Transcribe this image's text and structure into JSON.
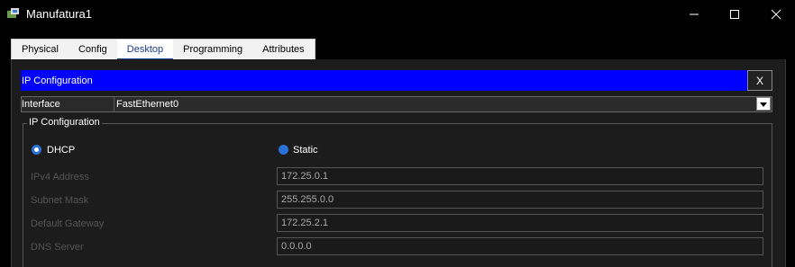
{
  "window": {
    "title": "Manufatura1"
  },
  "tabs": [
    {
      "label": "Physical",
      "active": false
    },
    {
      "label": "Config",
      "active": false
    },
    {
      "label": "Desktop",
      "active": true
    },
    {
      "label": "Programming",
      "active": false
    },
    {
      "label": "Attributes",
      "active": false
    }
  ],
  "header": {
    "title": "IP Configuration",
    "close_label": "X",
    "bar_color": "#0000ff"
  },
  "interface": {
    "label": "Interface",
    "value": "FastEthernet0"
  },
  "ip_config": {
    "group_title": "IP Configuration",
    "dhcp_label": "DHCP",
    "static_label": "Static",
    "selected_mode": "DHCP",
    "fields": [
      {
        "label": "IPv4 Address",
        "value": "172.25.0.1"
      },
      {
        "label": "Subnet Mask",
        "value": "255.255.0.0"
      },
      {
        "label": "Default Gateway",
        "value": "172.25.2.1"
      },
      {
        "label": "DNS Server",
        "value": "0.0.0.0"
      }
    ]
  },
  "icons": [
    "app-icon",
    "minimize-icon",
    "maximize-icon",
    "close-icon",
    "dropdown-arrow-icon"
  ]
}
